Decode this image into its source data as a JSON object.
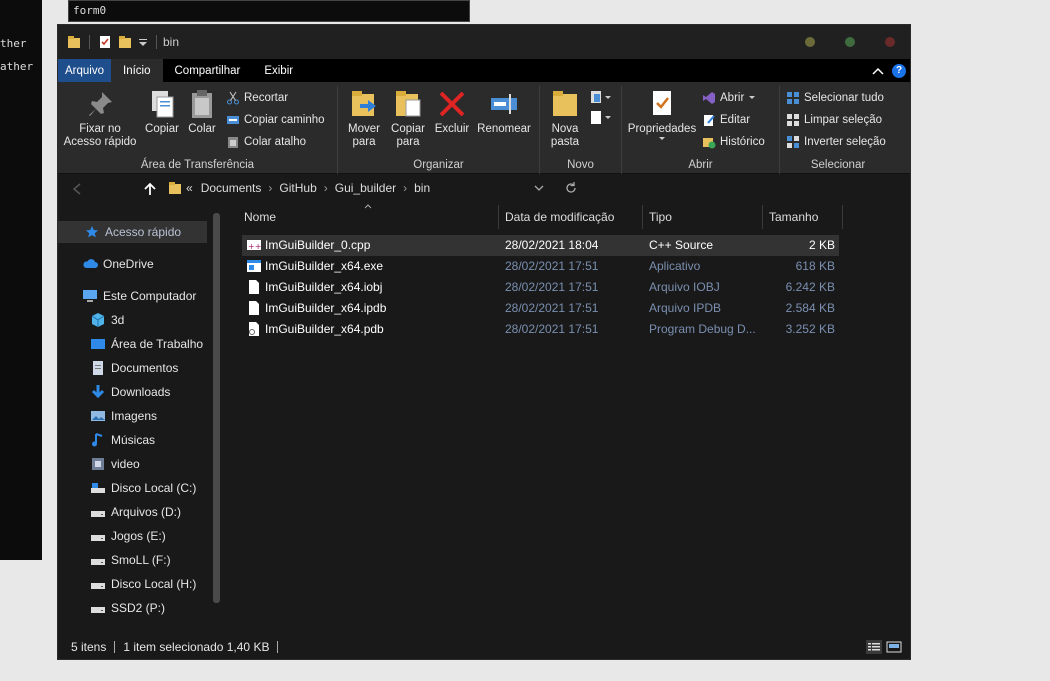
{
  "background": {
    "terminal_lines": [
      "ther",
      "ather"
    ],
    "terminal_title": "form0"
  },
  "window": {
    "title": "bin"
  },
  "tabs": {
    "file": "Arquivo",
    "home": "Início",
    "share": "Compartilhar",
    "view": "Exibir"
  },
  "ribbon": {
    "clipboard": {
      "label": "Área de Transferência",
      "pin": "Fixar no Acesso rápido",
      "copy": "Copiar",
      "paste": "Colar",
      "cut": "Recortar",
      "copy_path": "Copiar caminho",
      "paste_shortcut": "Colar atalho"
    },
    "organize": {
      "label": "Organizar",
      "move_to": "Mover para",
      "copy_to": "Copiar para",
      "delete": "Excluir",
      "rename": "Renomear"
    },
    "new": {
      "label": "Novo",
      "new_folder": "Nova pasta"
    },
    "open": {
      "label": "Abrir",
      "properties": "Propriedades",
      "open": "Abrir",
      "edit": "Editar",
      "history": "Histórico"
    },
    "select": {
      "label": "Selecionar",
      "select_all": "Selecionar tudo",
      "select_none": "Limpar seleção",
      "invert": "Inverter seleção"
    }
  },
  "address": {
    "overflow": "«",
    "crumbs": [
      "Documents",
      "GitHub",
      "Gui_builder",
      "bin"
    ]
  },
  "nav": [
    {
      "label": "Acesso rápido",
      "icon": "star-icon"
    },
    {
      "label": "OneDrive",
      "icon": "cloud-icon"
    },
    {
      "label": "Este Computador",
      "icon": "computer-icon"
    },
    {
      "label": "3d",
      "icon": "cube-icon"
    },
    {
      "label": "Área de Trabalho",
      "icon": "desktop-icon"
    },
    {
      "label": "Documentos",
      "icon": "document-icon"
    },
    {
      "label": "Downloads",
      "icon": "download-icon"
    },
    {
      "label": "Imagens",
      "icon": "image-icon"
    },
    {
      "label": "Músicas",
      "icon": "music-icon"
    },
    {
      "label": "video",
      "icon": "video-icon"
    },
    {
      "label": "Disco Local (C:)",
      "icon": "drive-icon"
    },
    {
      "label": "Arquivos (D:)",
      "icon": "drive-icon"
    },
    {
      "label": "Jogos (E:)",
      "icon": "drive-icon"
    },
    {
      "label": "SmoLL (F:)",
      "icon": "drive-icon"
    },
    {
      "label": "Disco Local (H:)",
      "icon": "drive-icon"
    },
    {
      "label": "SSD2 (P:)",
      "icon": "drive-icon"
    }
  ],
  "columns": {
    "name": "Nome",
    "date": "Data de modificação",
    "type": "Tipo",
    "size": "Tamanho"
  },
  "files": [
    {
      "name": "ImGuiBuilder_0.cpp",
      "date": "28/02/2021 18:04",
      "type": "C++ Source",
      "size": "2 KB",
      "icon": "cpp-file-icon"
    },
    {
      "name": "ImGuiBuilder_x64.exe",
      "date": "28/02/2021 17:51",
      "type": "Aplicativo",
      "size": "618 KB",
      "icon": "exe-file-icon"
    },
    {
      "name": "ImGuiBuilder_x64.iobj",
      "date": "28/02/2021 17:51",
      "type": "Arquivo IOBJ",
      "size": "6.242 KB",
      "icon": "file-icon"
    },
    {
      "name": "ImGuiBuilder_x64.ipdb",
      "date": "28/02/2021 17:51",
      "type": "Arquivo IPDB",
      "size": "2.584 KB",
      "icon": "file-icon"
    },
    {
      "name": "ImGuiBuilder_x64.pdb",
      "date": "28/02/2021 17:51",
      "type": "Program Debug D...",
      "size": "3.252 KB",
      "icon": "pdb-file-icon"
    }
  ],
  "status": {
    "count": "5 itens",
    "selection": "1 item selecionado  1,40 KB"
  },
  "colors": {
    "accent": "#1f4e8c",
    "selection": "#333333",
    "dim_text": "#7a8fb0"
  }
}
